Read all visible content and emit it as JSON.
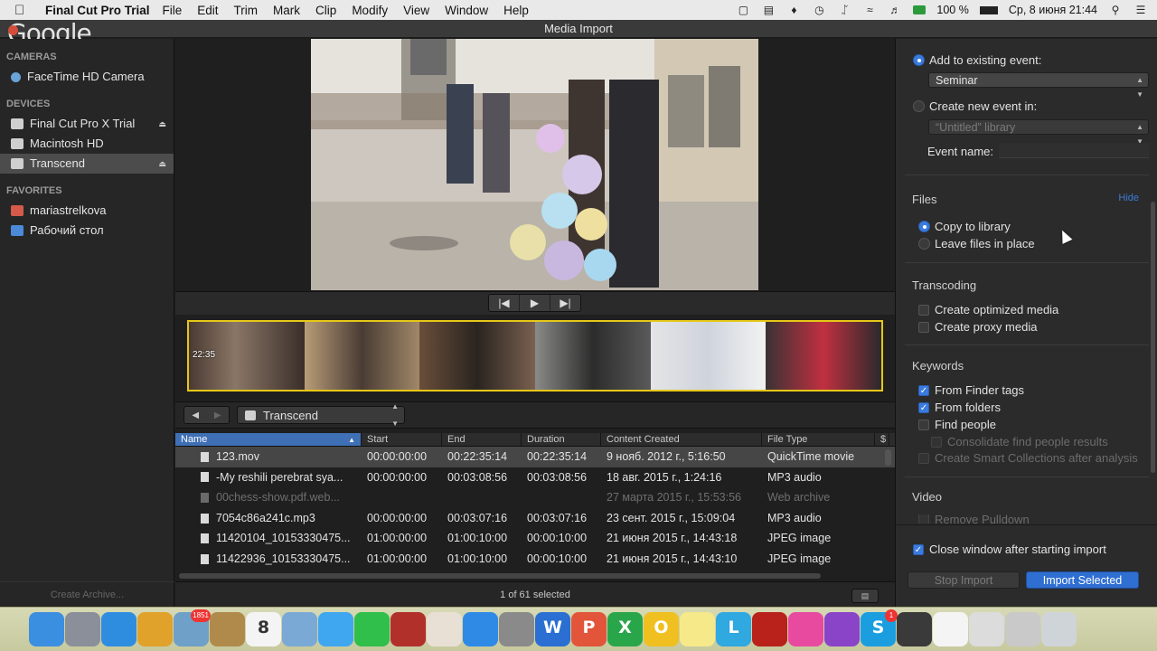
{
  "menubar": {
    "app_name": "Final Cut Pro Trial",
    "menus": [
      "File",
      "Edit",
      "Trim",
      "Mark",
      "Clip",
      "Modify",
      "View",
      "Window",
      "Help"
    ],
    "battery": "100 %",
    "datetime": "Ср, 8 июня  21:44"
  },
  "window": {
    "title": "Media Import"
  },
  "overlay_logo": "Google",
  "sidebar": {
    "cameras_header": "CAMERAS",
    "cameras": [
      {
        "label": "FaceTime HD Camera"
      }
    ],
    "devices_header": "DEVICES",
    "devices": [
      {
        "label": "Final Cut Pro X Trial",
        "eject": true
      },
      {
        "label": "Macintosh HD",
        "eject": false
      },
      {
        "label": "Transcend",
        "eject": true,
        "selected": true
      }
    ],
    "favorites_header": "FAVORITES",
    "favorites": [
      {
        "label": "mariastrelkova"
      },
      {
        "label": "Рабочий стол"
      }
    ],
    "create_archive": "Create Archive..."
  },
  "filmstrip": {
    "timecode": "22:35"
  },
  "browser": {
    "location": "Transcend",
    "columns": [
      "Name",
      "Start",
      "End",
      "Duration",
      "Content Created",
      "File Type"
    ],
    "rows": [
      {
        "name": "123.mov",
        "start": "00:00:00:00",
        "end": "00:22:35:14",
        "duration": "00:22:35:14",
        "created": "9 нояб. 2012 г., 5:16:50",
        "type": "QuickTime movie",
        "selected": true
      },
      {
        "name": "-My reshili perebrat sya...",
        "start": "00:00:00:00",
        "end": "00:03:08:56",
        "duration": "00:03:08:56",
        "created": "18 авг. 2015 г., 1:24:16",
        "type": "MP3 audio"
      },
      {
        "name": "00chess-show.pdf.web...",
        "start": "",
        "end": "",
        "duration": "",
        "created": "27 марта 2015 г., 15:53:56",
        "type": "Web archive",
        "dim": true
      },
      {
        "name": "7054c86a241c.mp3",
        "start": "00:00:00:00",
        "end": "00:03:07:16",
        "duration": "00:03:07:16",
        "created": "23 сент. 2015 г., 15:09:04",
        "type": "MP3 audio"
      },
      {
        "name": "11420104_10153330475...",
        "start": "01:00:00:00",
        "end": "01:00:10:00",
        "duration": "00:00:10:00",
        "created": "21 июня 2015 г., 14:43:18",
        "type": "JPEG image"
      },
      {
        "name": "11422936_10153330475...",
        "start": "01:00:00:00",
        "end": "01:00:10:00",
        "duration": "00:00:10:00",
        "created": "21 июня 2015 г., 14:43:10",
        "type": "JPEG image"
      }
    ],
    "status": "1 of 61 selected"
  },
  "import": {
    "add_existing_label": "Add to existing event:",
    "event_select": "Seminar",
    "create_new_label": "Create new event in:",
    "library_select": "“Untitled” library",
    "event_name_label": "Event name:",
    "files_header": "Files",
    "hide_label": "Hide",
    "copy_label": "Copy to library",
    "leave_label": "Leave files in place",
    "transcoding_header": "Transcoding",
    "optimized_label": "Create optimized media",
    "proxy_label": "Create proxy media",
    "keywords_header": "Keywords",
    "finder_tags_label": "From Finder tags",
    "folders_label": "From folders",
    "find_people_label": "Find people",
    "consolidate_label": "Consolidate find people results",
    "smart_collections_label": "Create Smart Collections after analysis",
    "video_header": "Video",
    "remove_pulldown_label": "Remove Pulldown",
    "close_window_label": "Close window after starting import",
    "stop_button": "Stop Import",
    "import_button": "Import Selected"
  },
  "dock": {
    "apps": [
      {
        "name": "finder-icon",
        "color": "#3b8fe0",
        "letter": ""
      },
      {
        "name": "launchpad-icon",
        "color": "#8a8f99",
        "letter": ""
      },
      {
        "name": "safari-icon",
        "color": "#2f8de0",
        "letter": ""
      },
      {
        "name": "chrome-icon",
        "color": "#e0a22a",
        "letter": ""
      },
      {
        "name": "preview-icon",
        "color": "#6fa0c8",
        "letter": "",
        "badge": "1851"
      },
      {
        "name": "contacts-icon",
        "color": "#b08a4a",
        "letter": ""
      },
      {
        "name": "calendar-icon",
        "color": "#f4f4f4",
        "letter": "8"
      },
      {
        "name": "photos-browser-icon",
        "color": "#7aa9d6",
        "letter": ""
      },
      {
        "name": "messages-icon",
        "color": "#3fa7f0",
        "letter": ""
      },
      {
        "name": "facetime-icon",
        "color": "#2fbf4a",
        "letter": ""
      },
      {
        "name": "photo-booth-icon",
        "color": "#b2302a",
        "letter": ""
      },
      {
        "name": "photos-icon",
        "color": "#e8e0d4",
        "letter": ""
      },
      {
        "name": "app-store-icon",
        "color": "#2f8ae6",
        "letter": ""
      },
      {
        "name": "system-preferences-icon",
        "color": "#8a8a8a",
        "letter": ""
      },
      {
        "name": "word-icon",
        "color": "#2a6fd1",
        "letter": "W"
      },
      {
        "name": "powerpoint-icon",
        "color": "#e2553a",
        "letter": "P"
      },
      {
        "name": "excel-icon",
        "color": "#2aa64a",
        "letter": "X"
      },
      {
        "name": "outlook-icon",
        "color": "#f0c020",
        "letter": "O"
      },
      {
        "name": "notes-icon",
        "color": "#f5e98a",
        "letter": ""
      },
      {
        "name": "lync-icon",
        "color": "#30a8e0",
        "letter": "L"
      },
      {
        "name": "acrobat-icon",
        "color": "#b8221a",
        "letter": ""
      },
      {
        "name": "itunes-icon",
        "color": "#e84aa0",
        "letter": ""
      },
      {
        "name": "podcast-icon",
        "color": "#8a44c8",
        "letter": ""
      },
      {
        "name": "skype-icon",
        "color": "#1a9ee0",
        "letter": "S",
        "badge": "1"
      },
      {
        "name": "final-cut-pro-icon",
        "color": "#3a3a3a",
        "letter": ""
      },
      {
        "name": "document-icon",
        "color": "#f4f4f4",
        "letter": ""
      },
      {
        "name": "screenshot-icon",
        "color": "#dcdcdc",
        "letter": ""
      },
      {
        "name": "downloads-icon",
        "color": "#c9c9c9",
        "letter": ""
      },
      {
        "name": "trash-icon",
        "color": "#cfd4d8",
        "letter": ""
      }
    ]
  }
}
